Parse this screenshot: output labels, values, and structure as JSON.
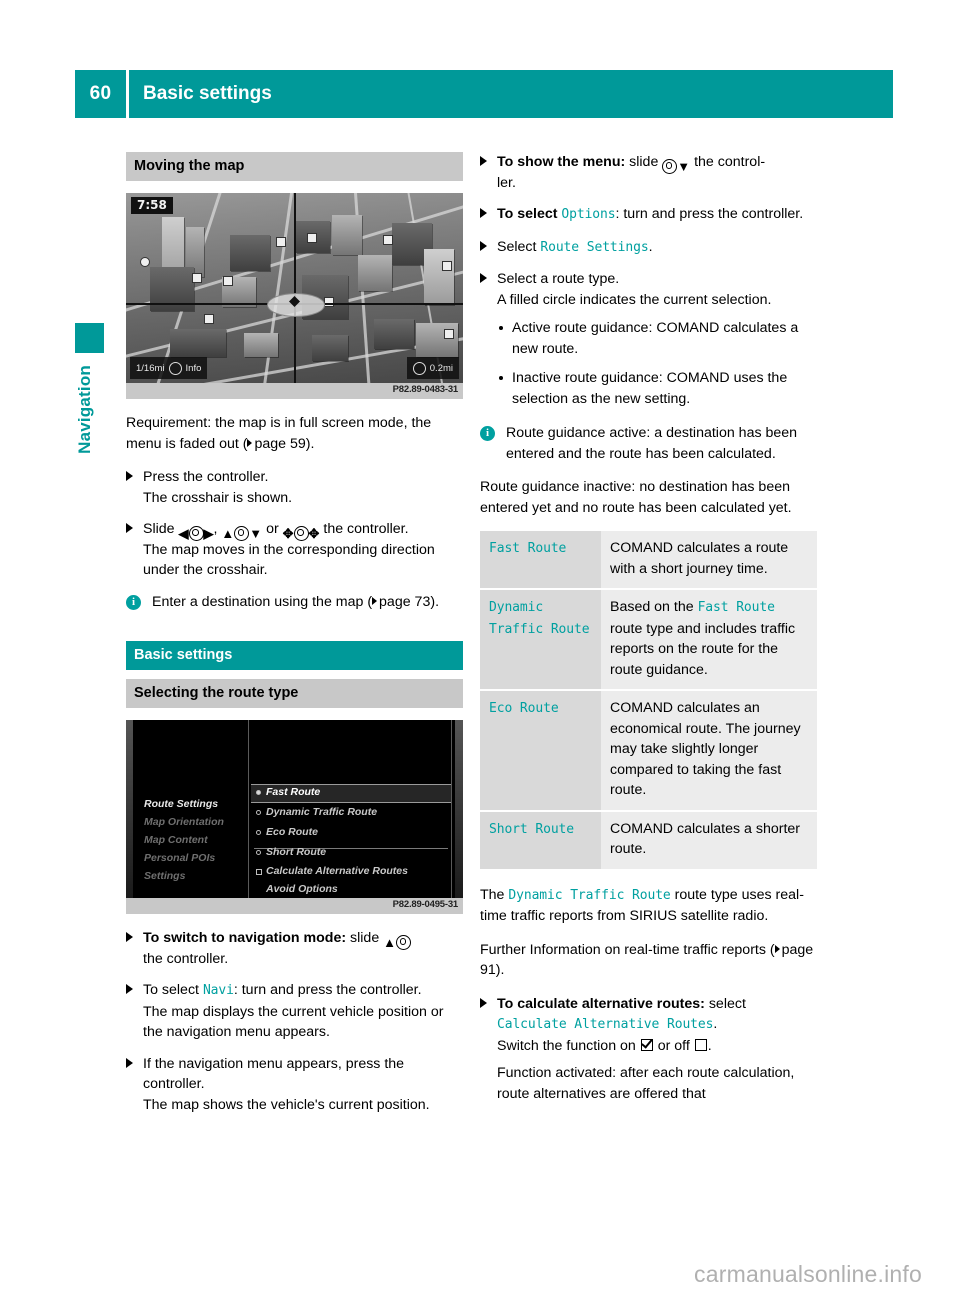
{
  "header": {
    "page_number": "60",
    "title": "Basic settings",
    "accent_color": "#009999"
  },
  "side_tab": {
    "label": "Navigation",
    "color": "#009999"
  },
  "left_column": {
    "heading_moving_the_map": "Moving the map",
    "figure_map": {
      "caption_code": "P82.89-0483-31",
      "time": "7:58",
      "scale_left": "1/16mi",
      "info_label": "Info",
      "scale_right": "0.2mi"
    },
    "requirement": {
      "text_before": "Requirement: the map is in full screen mode, the menu is faded out (",
      "page_ref": "page 59",
      "text_after": ")."
    },
    "step_press_controller": "Press the controller.",
    "step_press_controller_result": "The crosshair is shown.",
    "step_slide_prefix": "Slide ",
    "step_slide_suffix": " the controller.",
    "step_slide_result": "The map moves in the corresponding direction under the crosshair.",
    "note_enter_destination": {
      "text_before": "Enter a destination using the map (",
      "page_ref": "page 73",
      "text_after": ")."
    },
    "heading_basic_settings": "Basic settings",
    "heading_selecting_route_type": "Selecting the route type",
    "figure_menu": {
      "caption_code": "P82.89-0495-31",
      "left_items": [
        "Route Settings",
        "Map Orientation",
        "Map Content",
        "Personal POIs",
        "Settings"
      ],
      "right_items": [
        "Fast Route",
        "Dynamic Traffic Route",
        "Eco Route",
        "Short Route",
        "Calculate Alternative Routes",
        "Avoid Options"
      ]
    },
    "step_switch_nav_mode_bold": "To switch to navigation mode:",
    "step_switch_nav_mode_text": " slide ",
    "step_switch_nav_mode_after": " the controller.",
    "step_select_navi_before": "To select ",
    "step_select_navi_term": "Navi",
    "step_select_navi_after": ": turn and press the controller.",
    "step_select_navi_result": "The map displays the current vehicle position or the navigation menu appears.",
    "step_nav_menu_appears": "If the navigation menu appears, press the controller.",
    "step_nav_menu_result": "The map shows the vehicle's current position."
  },
  "right_column": {
    "step_show_menu_bold": "To show the menu:",
    "step_show_menu_text": " slide ",
    "step_show_menu_after": " the controller.",
    "step_select_options_bold_before": "To select ",
    "step_select_options_term": "Options",
    "step_select_options_after": ": turn and press the controller.",
    "step_select_route_settings_before": "Select ",
    "step_select_route_settings_term": "Route Settings",
    "step_select_route_settings_after": ".",
    "step_select_route_type": "Select a route type.",
    "step_select_route_type_result": "A filled circle indicates the current selection.",
    "subbullet_active": "Active route guidance: COMAND calculates a new route.",
    "subbullet_inactive": "Inactive route guidance: COMAND uses the selection as the new setting.",
    "note_route_guidance_1": "Route guidance active: a destination has been entered and the route has been calculated.",
    "note_route_guidance_2": "Route guidance inactive: no destination has been entered yet and no route has been calculated yet.",
    "table": {
      "rows": [
        {
          "term": "Fast Route",
          "desc_parts": [
            {
              "type": "text",
              "value": "COMAND calculates a route with a short journey time."
            }
          ]
        },
        {
          "term": "Dynamic Traffic Route",
          "desc_parts": [
            {
              "type": "text",
              "value": "Based on the "
            },
            {
              "type": "term",
              "value": "Fast Route"
            },
            {
              "type": "text",
              "value": " route type and includes traffic reports on the route for the route guidance."
            }
          ]
        },
        {
          "term": "Eco Route",
          "desc_parts": [
            {
              "type": "text",
              "value": "COMAND calculates an economical route. The journey may take slightly longer compared to taking the fast route."
            }
          ]
        },
        {
          "term": "Short Route",
          "desc_parts": [
            {
              "type": "text",
              "value": "COMAND calculates a shorter route."
            }
          ]
        }
      ]
    },
    "para_dynamic_before": "The ",
    "para_dynamic_term": "Dynamic Traffic Route",
    "para_dynamic_after": " route type uses real-time traffic reports from SIRIUS satellite radio.",
    "para_further_before": "Further Information on real-time traffic reports (",
    "para_further_page_ref": "page 91",
    "para_further_after": ").",
    "step_calc_alt_bold": "To calculate alternative routes:",
    "step_calc_alt_text": " select ",
    "step_calc_alt_term": "Calculate Alternative Routes",
    "step_calc_alt_period": ".",
    "step_switch_function_before": "Switch the function on ",
    "step_switch_function_mid": " or off ",
    "step_switch_function_after": ".",
    "step_function_activated": "Function activated: after each route calculation, route alternatives are offered that"
  },
  "footer": {
    "watermark": "carmanualsonline.info"
  }
}
